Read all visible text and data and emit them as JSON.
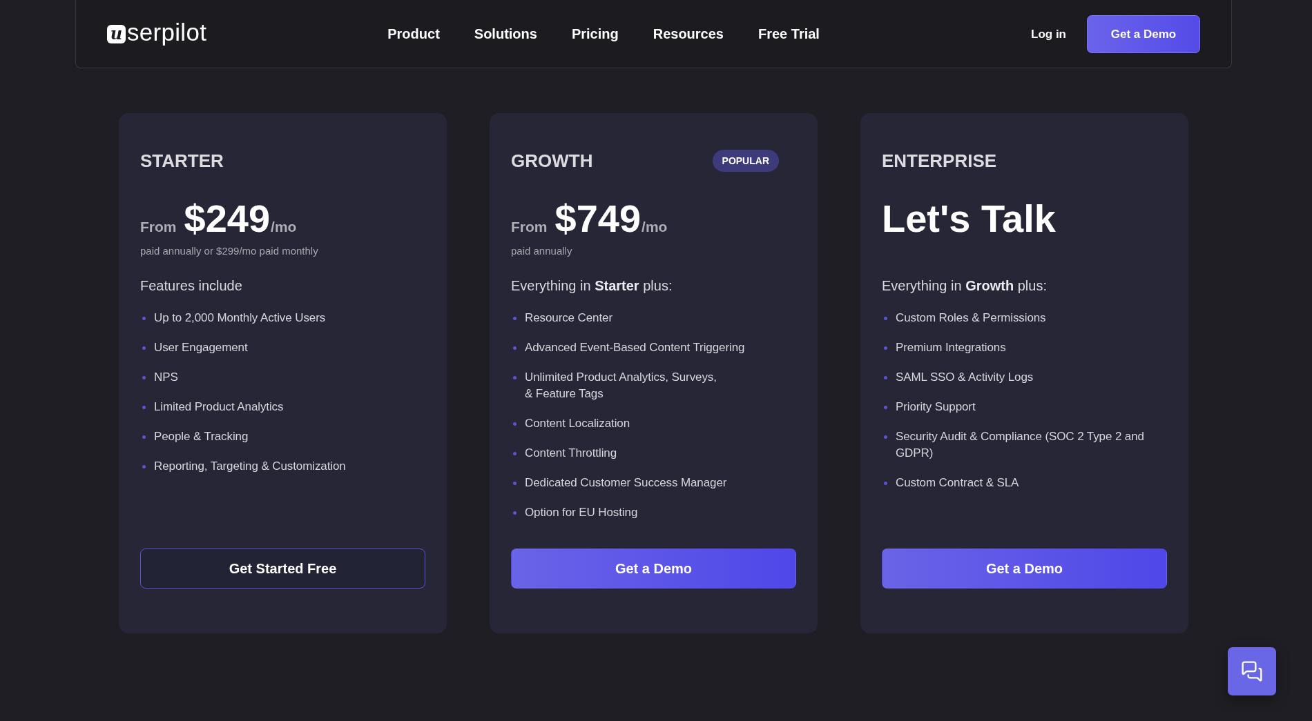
{
  "nav": {
    "logo": {
      "mark": "u",
      "text": "serpilot"
    },
    "links": [
      "Product",
      "Solutions",
      "Pricing",
      "Resources",
      "Free Trial"
    ],
    "login": "Log in",
    "cta": "Get a Demo"
  },
  "plans": [
    {
      "kind": "priced",
      "name": "STARTER",
      "prefix": "From",
      "price": "$249",
      "period": "/mo",
      "note": "paid annually or $299/mo paid monthly",
      "intro": "Features include",
      "features": [
        "Up to 2,000 Monthly Active Users",
        "User Engagement",
        "NPS",
        "Limited Product Analytics",
        "People & Tracking",
        "Reporting, Targeting & Customization"
      ],
      "button": {
        "kind": "outline",
        "label": "Get Started Free"
      }
    },
    {
      "kind": "priced",
      "name": "GROWTH",
      "badge": "POPULAR",
      "prefix": "From",
      "price": "$749",
      "period": "/mo",
      "note": "paid annually",
      "intro": "Everything in **Starter** plus:",
      "features": [
        "Resource Center",
        "Advanced Event-Based Content Triggering",
        "Unlimited Product Analytics, Surveys,\n& Feature Tags",
        "Content Localization",
        "Content Throttling",
        "Dedicated Customer Success Manager",
        "Option for EU Hosting"
      ],
      "button": {
        "kind": "filled",
        "label": "Get a Demo"
      }
    },
    {
      "kind": "contact",
      "name": "ENTERPRISE",
      "headline": "Let's Talk",
      "intro": "Everything in **Growth** plus:",
      "features": [
        "Custom Roles & Permissions",
        "Premium Integrations",
        "SAML SSO & Activity Logs",
        "Priority Support",
        "Security Audit & Compliance (SOC 2 Type 2 and GDPR)",
        "Custom Contract & SLA"
      ],
      "button": {
        "kind": "filled",
        "label": "Get a Demo"
      }
    }
  ]
}
